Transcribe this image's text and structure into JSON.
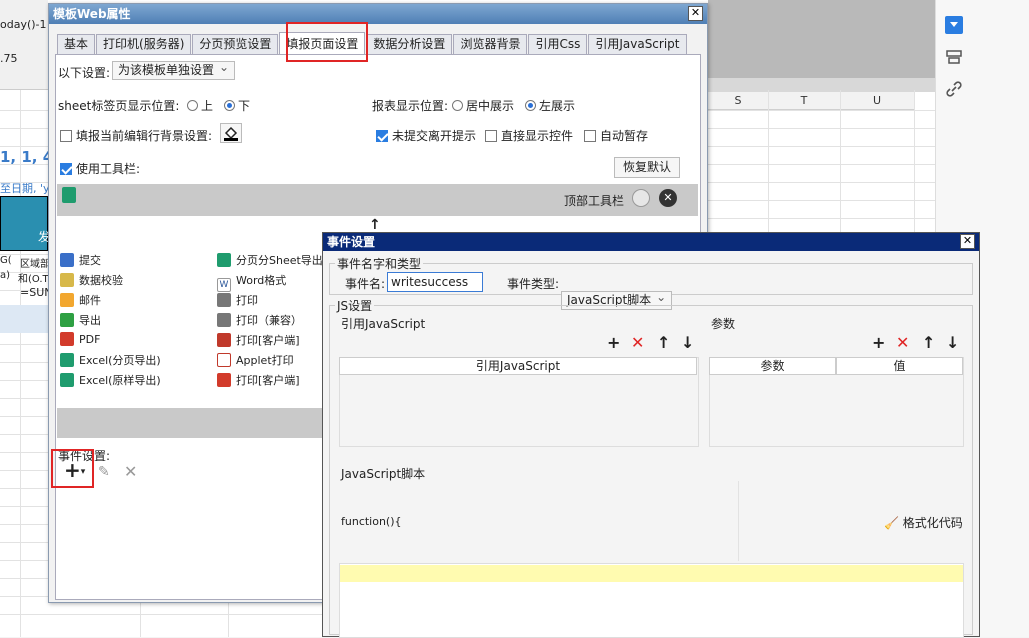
{
  "background_sheet": {
    "formula_fragment": "oday()-1",
    "cell_value_75": ".75",
    "col_letters": [
      "S",
      "T",
      "U"
    ],
    "big_text": "1, 1, 4",
    "sub_text": "至日期, 'y,",
    "hdr_fragment": "发",
    "cell_a": "G(",
    "cell_b": "区域部",
    "cell_c": "和(O.T",
    "cell_d": "a)",
    "cell_e": "=SUN"
  },
  "web_dialog": {
    "title": "模板Web属性",
    "close": "✕",
    "tabs": [
      "基本",
      "打印机(服务器)",
      "分页预览设置",
      "填报页面设置",
      "数据分析设置",
      "浏览器背景",
      "引用Css",
      "引用JavaScript"
    ],
    "settings_label": "以下设置:",
    "settings_value": "为该模板单独设置",
    "sheet_pos_label": "sheet标签页显示位置:",
    "sheet_top": "上",
    "sheet_bottom": "下",
    "report_pos_label": "报表显示位置:",
    "report_center": "居中展示",
    "report_left": "左展示",
    "fill_bg_label": "填报当前编辑行背景设置:",
    "unsubmit_label": "未提交离开提示",
    "direct_show_label": "直接显示控件",
    "auto_save_label": "自动暂存",
    "use_toolbar_label": "使用工具栏:",
    "restore_default": "恢复默认",
    "top_toolbar_label": "顶部工具栏",
    "tools_left": [
      "提交",
      "数据校验",
      "邮件",
      "导出",
      "PDF",
      "Excel(分页导出)",
      "Excel(原样导出)"
    ],
    "tools_right": [
      "分页分Sheet导出",
      "Word格式",
      "打印",
      "打印（兼容）",
      "打印[客户端]",
      "Applet打印",
      "打印[客户端]"
    ],
    "event_settings_label": "事件设置:",
    "add_symbol": "+"
  },
  "event_dialog": {
    "title": "事件设置",
    "close": "✕",
    "name_type_group": "事件名字和类型",
    "event_name_label": "事件名:",
    "event_name_value": "writesuccess",
    "event_type_label": "事件类型:",
    "event_type_value": "JavaScript脚本",
    "js_group": "JS设置",
    "ref_js_label": "引用JavaScript",
    "params_label": "参数",
    "ref_js_col": "引用JavaScript",
    "param_col": "参数",
    "value_col": "值",
    "script_group": "JavaScript脚本",
    "function_text": "function(){",
    "format_code": "格式化代码"
  },
  "colors": {
    "title_blue": "#4f7fb5",
    "event_title": "#0a2a78",
    "highlight_red": "#e02525",
    "accent_blue": "#2a7de1",
    "code_line": "#fffbb0"
  }
}
